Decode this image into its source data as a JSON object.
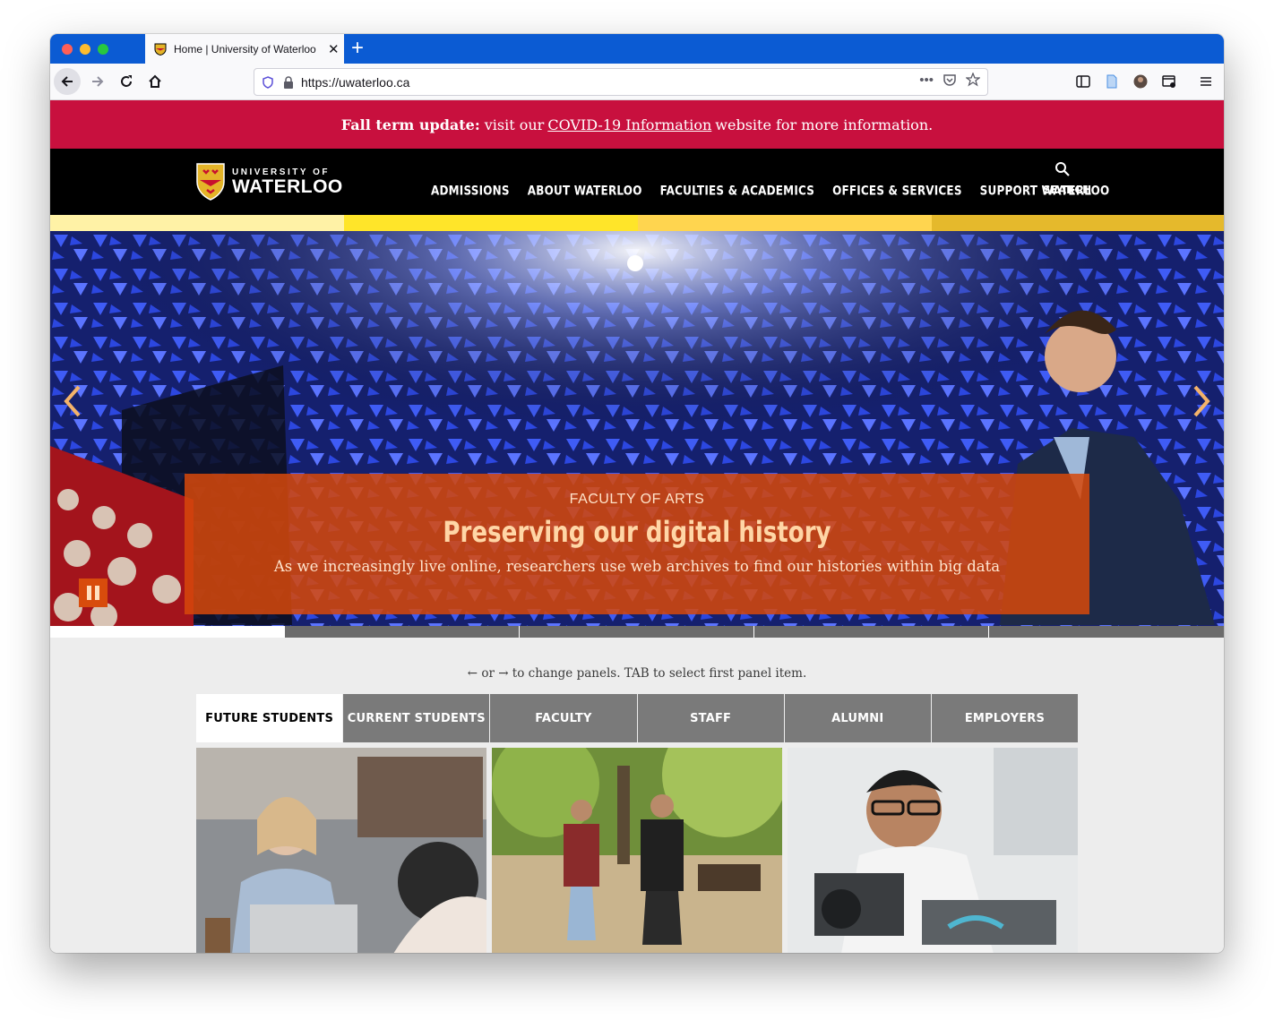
{
  "browser": {
    "tab_title": "Home | University of Waterloo",
    "tab_close": "✕",
    "new_tab": "+",
    "url": "https://uwaterloo.ca",
    "url_more": "•••"
  },
  "alert": {
    "bold": "Fall term update:",
    "text_before": "visit our",
    "link": "COVID-19 Information",
    "text_after": "website for more information."
  },
  "header": {
    "logo_top": "UNIVERSITY OF",
    "logo_bottom": "WATERLOO",
    "nav": [
      "ADMISSIONS",
      "ABOUT WATERLOO",
      "FACULTIES & ACADEMICS",
      "OFFICES & SERVICES",
      "SUPPORT WATERLOO"
    ],
    "search_label": "SEARCH"
  },
  "stripe_colors": [
    "#fff2a6",
    "#ffe529",
    "#ffd54f",
    "#e5b92c"
  ],
  "hero": {
    "kicker": "FACULTY OF ARTS",
    "title": "Preserving our digital history",
    "subtitle": "As we increasingly live online, researchers use web archives to find our histories within big data"
  },
  "hint": "← or → to change panels. TAB to select first panel item.",
  "audience_tabs": [
    "FUTURE STUDENTS",
    "CURRENT STUDENTS",
    "FACULTY",
    "STAFF",
    "ALUMNI",
    "EMPLOYERS"
  ],
  "colors": {
    "alert_bg": "#c8103e",
    "caption_bg": "#d6480a",
    "header_bg": "#000000"
  }
}
